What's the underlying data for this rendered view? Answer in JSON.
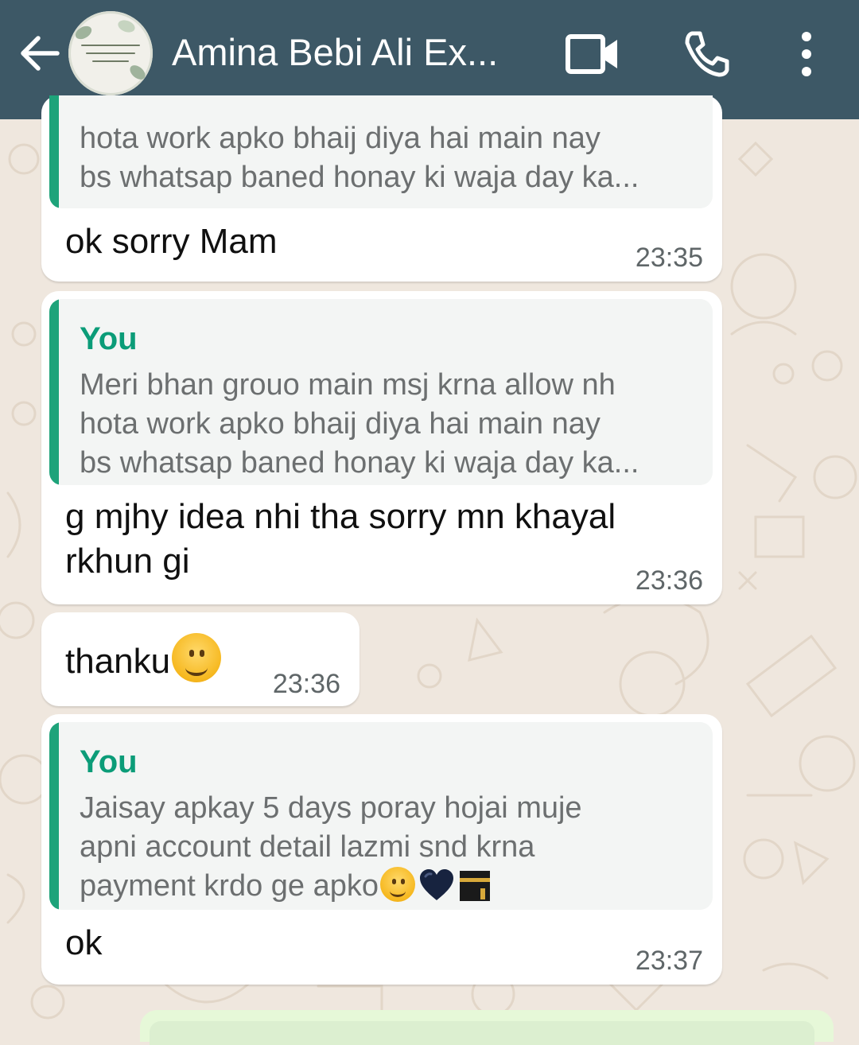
{
  "header": {
    "title": "Amina Bebi Ali Ex...",
    "back_icon": "arrow-left-icon",
    "video_icon": "video-call-icon",
    "call_icon": "phone-icon",
    "menu_icon": "more-vert-icon",
    "background_color": "#3d5866"
  },
  "messages": [
    {
      "quote_text": "hota work apko bhaij diya hai main nay\nbs whatsap baned honay ki waja day ka...",
      "text": "ok sorry Mam",
      "time": "23:35"
    },
    {
      "quote_author": "You",
      "quote_text": "Meri bhan grouo main msj krna allow nh\nhota work apko bhaij diya hai main nay\nbs whatsap baned honay ki waja day ka...",
      "text": "g mjhy idea nhi tha sorry mn khayal rkhun gi",
      "time": "23:36"
    },
    {
      "text": "thanku",
      "emoji": "smiling-face-emoji",
      "time": "23:36"
    },
    {
      "quote_author": "You",
      "quote_text_lines": [
        "Jaisay apkay 5 days poray hojai muje",
        "apni account detail lazmi snd krna",
        "payment krdo ge apko"
      ],
      "quote_emojis": [
        "smiling-face-emoji",
        "dark-heart-emoji",
        "kaaba-emoji"
      ],
      "text": "ok",
      "time": "23:37"
    }
  ],
  "colors": {
    "quote_accent": "#1ea37a",
    "quote_author": "#0b9c78",
    "chat_background": "#efe7de"
  }
}
